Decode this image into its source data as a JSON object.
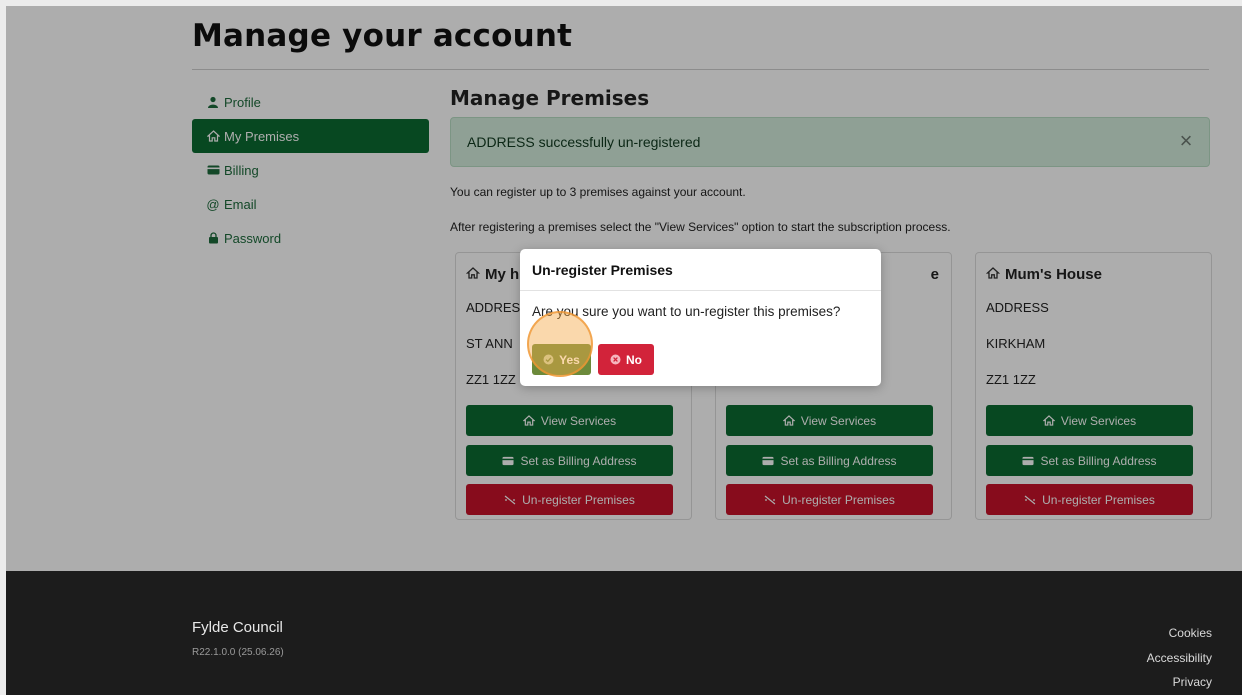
{
  "page": {
    "title": "Manage your account"
  },
  "sidebar": {
    "items": [
      {
        "label": "Profile",
        "icon": "person-icon",
        "active": false
      },
      {
        "label": "My Premises",
        "icon": "home-icon",
        "active": true
      },
      {
        "label": "Billing",
        "icon": "card-icon",
        "active": false
      },
      {
        "label": "Email",
        "icon": "at-icon",
        "active": false
      },
      {
        "label": "Password",
        "icon": "lock-icon",
        "active": false
      }
    ]
  },
  "main": {
    "section_title": "Manage Premises",
    "alert": {
      "text": "ADDRESS successfully un-registered",
      "close_icon": "close-icon"
    },
    "info_1": "You can register up to 3 premises against your account.",
    "info_2": "After registering a premises select the \"View Services\" option to start the subscription process."
  },
  "cards": [
    {
      "title": "My h",
      "address_line1": "ADDRES",
      "address_line2": "ST ANN",
      "postcode": "ZZ1 1ZZ",
      "view_label": "View Services",
      "billing_label": "Set as Billing Address",
      "unregister_label": "Un-register Premises"
    },
    {
      "title": "e",
      "address_line1": "",
      "address_line2": "",
      "postcode": "",
      "view_label": "View Services",
      "billing_label": "Set as Billing Address",
      "unregister_label": "Un-register Premises"
    },
    {
      "title": "Mum's House",
      "address_line1": "ADDRESS",
      "address_line2": "KIRKHAM",
      "postcode": "ZZ1 1ZZ",
      "view_label": "View Services",
      "billing_label": "Set as Billing Address",
      "unregister_label": "Un-register Premises"
    }
  ],
  "modal": {
    "title": "Un-register Premises",
    "body": "Are you sure you want to un-register this premises?",
    "yes_label": "Yes",
    "no_label": "No"
  },
  "footer": {
    "brand": "Fylde Council",
    "version": "R22.1.0.0  (25.06.26)",
    "links": [
      "Cookies",
      "Accessibility",
      "Privacy"
    ]
  },
  "colors": {
    "primary_green": "#0b6a31",
    "danger_red": "#c7132a",
    "alert_bg": "#d3ecdc",
    "footer_bg": "#1c1c1c"
  }
}
